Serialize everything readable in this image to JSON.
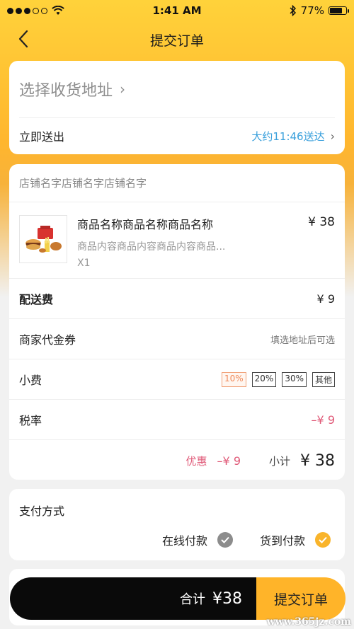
{
  "status_bar": {
    "time": "1:41 AM",
    "battery_text": "77%",
    "battery_level": 0.77
  },
  "nav": {
    "title": "提交订单"
  },
  "address": {
    "placeholder": "选择收货地址",
    "deliver_label": "立即送出",
    "deliver_time": "大约11:46送达"
  },
  "order": {
    "store_name": "店铺名字店铺名字店铺名字",
    "product": {
      "name": "商品名称商品名称商品名称",
      "price": "¥ 38",
      "desc": "商品内容商品内容商品内容商品...",
      "qty": "X1"
    },
    "delivery_fee_label": "配送费",
    "delivery_fee": "¥ 9",
    "coupon_label": "商家代金券",
    "coupon_hint": "填选地址后可选",
    "tip_label": "小费",
    "tip_options": [
      "10%",
      "20%",
      "30%",
      "其他"
    ],
    "tip_selected": "10%",
    "tax_label": "税率",
    "tax_value": "–¥ 9",
    "discount_label": "优惠",
    "discount_value": "–¥ 9",
    "subtotal_label": "小计",
    "subtotal_value": "¥ 38"
  },
  "payment": {
    "title": "支付方式",
    "online": "在线付款",
    "cod": "货到付款",
    "selected": "货到付款"
  },
  "bottom": {
    "total_label": "合计",
    "total_value": "¥38",
    "submit": "提交订单"
  },
  "watermark": "www.365jz.com",
  "colors": {
    "accent": "#ffb429",
    "link": "#3aa0dc",
    "discount": "#e05a78"
  }
}
